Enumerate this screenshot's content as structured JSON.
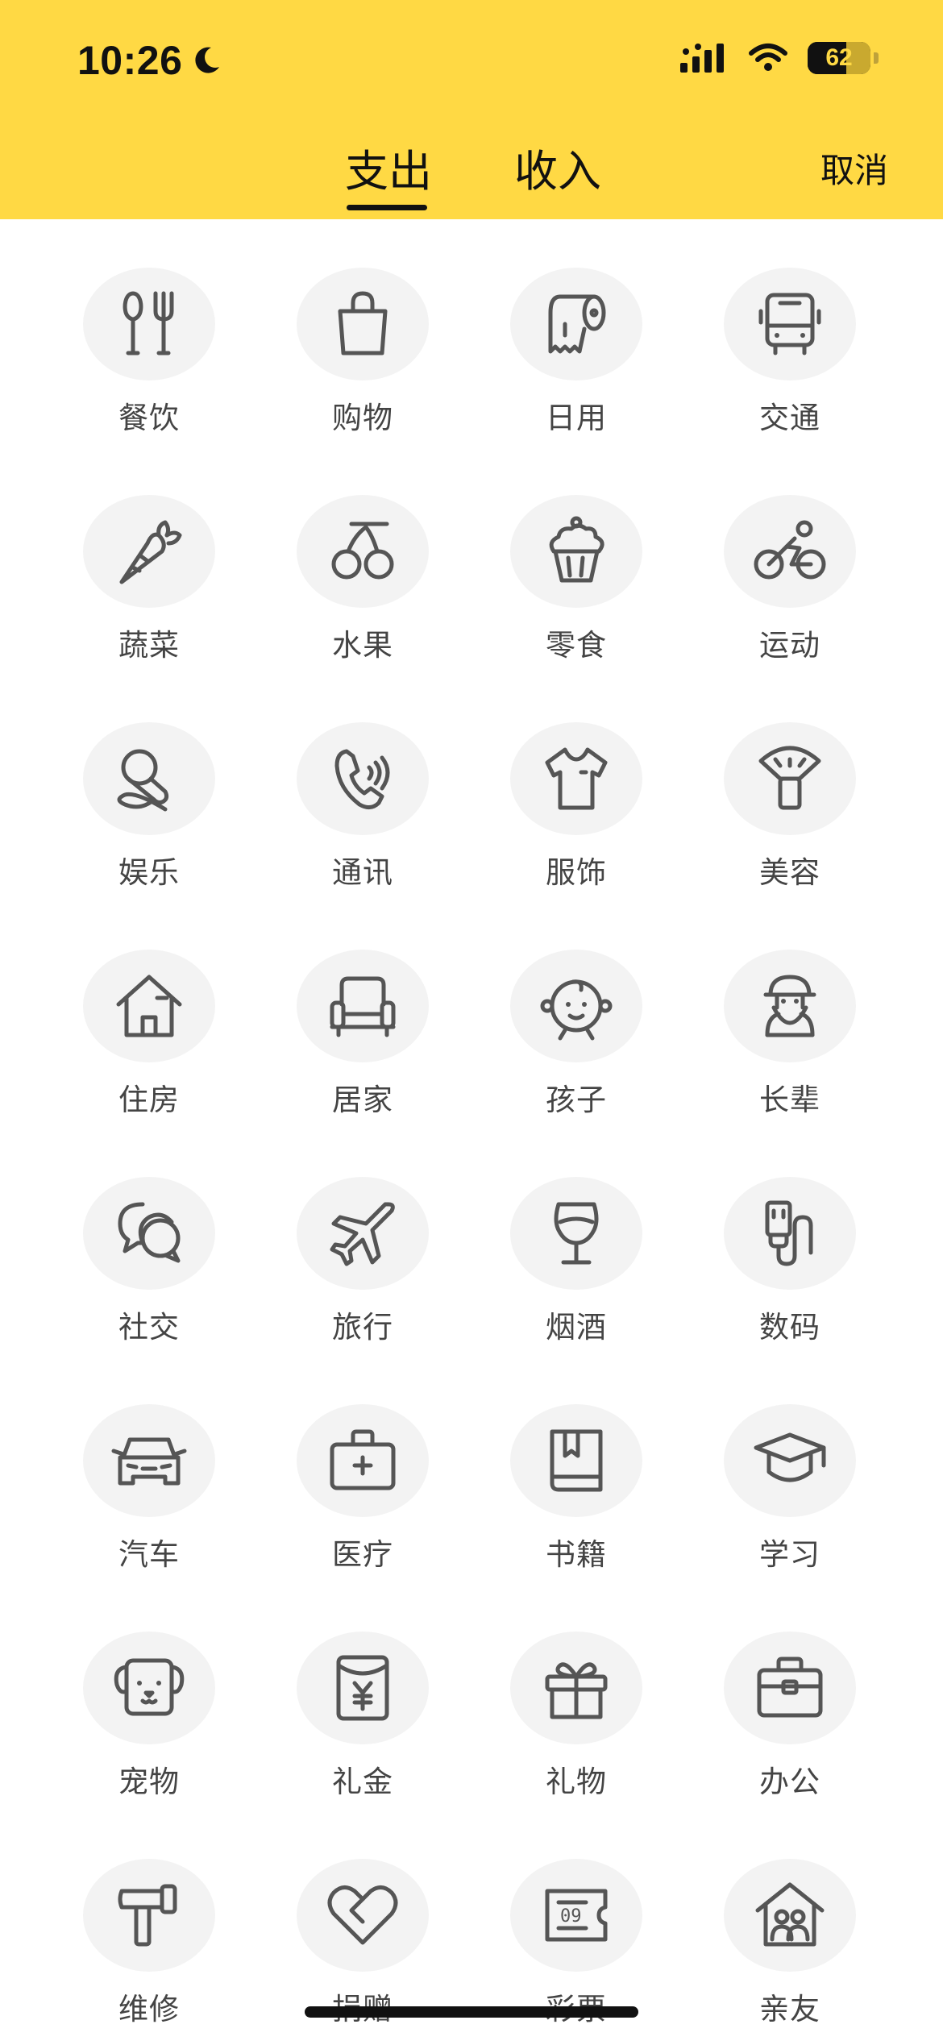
{
  "status_bar": {
    "time": "10:26",
    "battery": "62",
    "battery_level_percent": 62,
    "icons": [
      "moon-icon",
      "signal-icon",
      "wifi-icon",
      "battery-icon"
    ]
  },
  "header": {
    "tabs": [
      {
        "label": "支出",
        "selected": true
      },
      {
        "label": "收入",
        "selected": false
      }
    ],
    "cancel_label": "取消",
    "background_color": "#FFD944"
  },
  "categories": [
    {
      "label": "餐饮",
      "icon": "utensils-icon"
    },
    {
      "label": "购物",
      "icon": "shopping-bag-icon"
    },
    {
      "label": "日用",
      "icon": "toilet-paper-icon"
    },
    {
      "label": "交通",
      "icon": "bus-icon"
    },
    {
      "label": "蔬菜",
      "icon": "carrot-icon"
    },
    {
      "label": "水果",
      "icon": "cherries-icon"
    },
    {
      "label": "零食",
      "icon": "cupcake-icon"
    },
    {
      "label": "运动",
      "icon": "cyclist-icon"
    },
    {
      "label": "娱乐",
      "icon": "microphone-icon"
    },
    {
      "label": "通讯",
      "icon": "phone-call-icon"
    },
    {
      "label": "服饰",
      "icon": "tshirt-icon"
    },
    {
      "label": "美容",
      "icon": "lipstick-icon"
    },
    {
      "label": "住房",
      "icon": "house-icon"
    },
    {
      "label": "居家",
      "icon": "sofa-icon"
    },
    {
      "label": "孩子",
      "icon": "baby-face-icon"
    },
    {
      "label": "长辈",
      "icon": "elder-icon"
    },
    {
      "label": "社交",
      "icon": "chat-bubbles-icon"
    },
    {
      "label": "旅行",
      "icon": "airplane-icon"
    },
    {
      "label": "烟酒",
      "icon": "wine-glass-icon"
    },
    {
      "label": "数码",
      "icon": "usb-cable-icon"
    },
    {
      "label": "汽车",
      "icon": "car-icon"
    },
    {
      "label": "医疗",
      "icon": "medical-kit-icon"
    },
    {
      "label": "书籍",
      "icon": "book-icon"
    },
    {
      "label": "学习",
      "icon": "graduation-cap-icon"
    },
    {
      "label": "宠物",
      "icon": "dog-face-icon"
    },
    {
      "label": "礼金",
      "icon": "red-envelope-icon"
    },
    {
      "label": "礼物",
      "icon": "gift-icon"
    },
    {
      "label": "办公",
      "icon": "briefcase-icon"
    },
    {
      "label": "维修",
      "icon": "hammer-icon"
    },
    {
      "label": "捐赠",
      "icon": "heart-icon"
    },
    {
      "label": "彩票",
      "icon": "lottery-ticket-icon"
    },
    {
      "label": "亲友",
      "icon": "family-house-icon"
    }
  ]
}
